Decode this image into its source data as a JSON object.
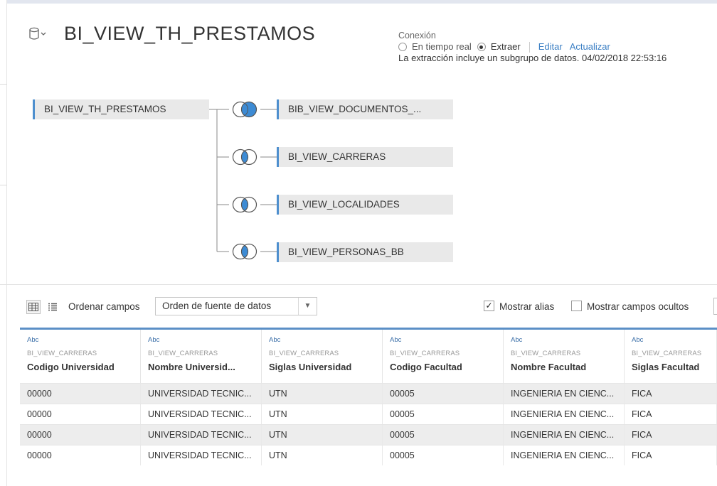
{
  "datasource": {
    "title": "BI_VIEW_TH_PRESTAMOS",
    "icon": "database-icon"
  },
  "connection": {
    "label": "Conexión",
    "option_live": "En tiempo real",
    "option_extract": "Extraer",
    "selected": "Extraer",
    "edit_link": "Editar",
    "refresh_link": "Actualizar",
    "extract_info": "La extracción incluye un subgrupo de datos. 04/02/2018 22:53:16"
  },
  "canvas": {
    "left_table": "BI_VIEW_TH_PRESTAMOS",
    "joined_tables": [
      {
        "name": "BIB_VIEW_DOCUMENTOS_...",
        "join_type": "right"
      },
      {
        "name": "BI_VIEW_CARRERAS",
        "join_type": "inner"
      },
      {
        "name": "BI_VIEW_LOCALIDADES",
        "join_type": "inner"
      },
      {
        "name": "BI_VIEW_PERSONAS_BB",
        "join_type": "inner"
      }
    ]
  },
  "toolbar": {
    "sort_label": "Ordenar campos",
    "sort_value": "Orden de fuente de datos",
    "show_alias_label": "Mostrar alias",
    "show_alias_checked": true,
    "show_hidden_label": "Mostrar campos ocultos",
    "show_hidden_checked": false
  },
  "grid": {
    "columns": [
      {
        "type": "Abc",
        "source": "BI_VIEW_CARRERAS",
        "name": "Codigo Universidad"
      },
      {
        "type": "Abc",
        "source": "BI_VIEW_CARRERAS",
        "name": "Nombre Universid..."
      },
      {
        "type": "Abc",
        "source": "BI_VIEW_CARRERAS",
        "name": "Siglas Universidad"
      },
      {
        "type": "Abc",
        "source": "BI_VIEW_CARRERAS",
        "name": "Codigo Facultad"
      },
      {
        "type": "Abc",
        "source": "BI_VIEW_CARRERAS",
        "name": "Nombre Facultad"
      },
      {
        "type": "Abc",
        "source": "BI_VIEW_CARRERAS",
        "name": "Siglas Facultad"
      }
    ],
    "rows": [
      [
        "00000",
        "UNIVERSIDAD TECNIC...",
        "UTN",
        "00005",
        "INGENIERIA EN CIENC...",
        "FICA"
      ],
      [
        "00000",
        "UNIVERSIDAD TECNIC...",
        "UTN",
        "00005",
        "INGENIERIA EN CIENC...",
        "FICA"
      ],
      [
        "00000",
        "UNIVERSIDAD TECNIC...",
        "UTN",
        "00005",
        "INGENIERIA EN CIENC...",
        "FICA"
      ],
      [
        "00000",
        "UNIVERSIDAD TECNIC...",
        "UTN",
        "00005",
        "INGENIERIA EN CIENC...",
        "FICA"
      ]
    ]
  },
  "colors": {
    "accent": "#4e8fce",
    "link": "#3b7fc4",
    "table_bg": "#e9e9e9",
    "join_fill": "#3d8bd4"
  }
}
